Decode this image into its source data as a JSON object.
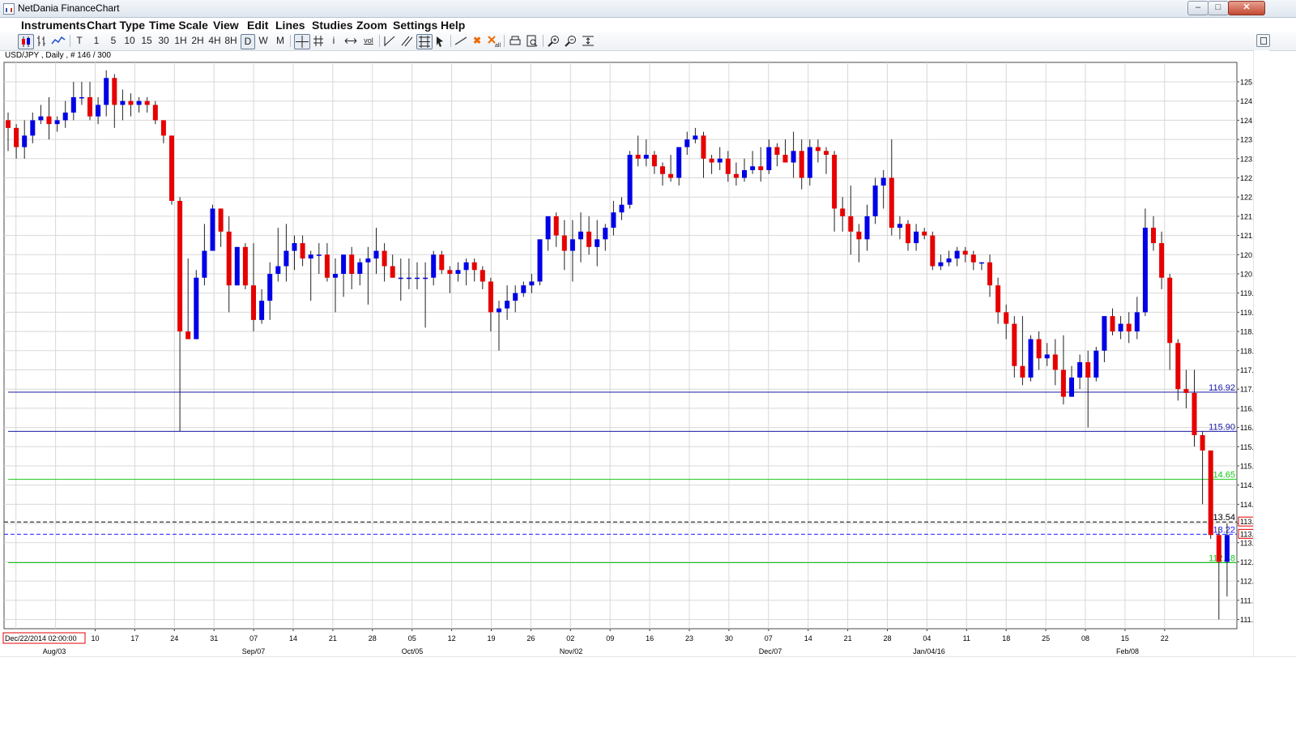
{
  "window": {
    "title": "NetDania FinanceChart",
    "min_glyph": "–",
    "max_glyph": "□",
    "close_glyph": "✕"
  },
  "menu": [
    "Instruments",
    "Chart Type",
    "Time Scale",
    "View",
    "Edit",
    "Lines",
    "Studies",
    "Zoom",
    "Settings",
    "Help"
  ],
  "toolbar": {
    "timescales": [
      "T",
      "1",
      "5",
      "10",
      "15",
      "30",
      "1H",
      "2H",
      "4H",
      "8H",
      "D",
      "W",
      "M"
    ],
    "active_timescale": "D",
    "icons": [
      "candle-chart-icon",
      "bar-chart-icon",
      "line-chart-icon",
      "crosshair-icon",
      "grid-icon",
      "info-icon",
      "scroll-arrows-icon",
      "volume-icon",
      "trendline-icon",
      "channel-icon",
      "fibonacci-icon",
      "cursor-icon",
      "draw-line-icon",
      "delete-icon",
      "delete-all-icon",
      "print-icon",
      "print-preview-icon",
      "zoom-in-icon",
      "zoom-out-icon",
      "zoom-fit-icon"
    ],
    "glyphs": {
      "volume": "vol",
      "info": "i",
      "delete": "✖"
    }
  },
  "instrument_info": "USD/JPY , Daily , # 146 / 300",
  "crosshair_date": "Dec/22/2014 02:00:00",
  "chart_data": {
    "type": "candlestick",
    "instrument": "USD/JPY",
    "timeframe": "Daily",
    "yaxis": {
      "min": 111.0,
      "max": 125.0,
      "step": 0.5,
      "position": "right"
    },
    "x_day_labels": [
      "10",
      "17",
      "24",
      "31",
      "07",
      "14",
      "21",
      "28",
      "05",
      "12",
      "19",
      "26",
      "02",
      "09",
      "16",
      "23",
      "30",
      "07",
      "14",
      "21",
      "28",
      "04",
      "11",
      "18",
      "25",
      "08",
      "15",
      "22"
    ],
    "x_month_labels": [
      "Aug/03",
      "Sep/07",
      "Oct/05",
      "Nov/02",
      "Dec/07",
      "Jan/04/16",
      "Feb/08"
    ],
    "grid": true,
    "horizontal_lines": [
      {
        "value": 116.92,
        "label": "116.92",
        "color": "#1a1aa6",
        "style": "solid"
      },
      {
        "value": 115.9,
        "label": "115.90",
        "color": "#1a1aa6",
        "style": "solid"
      },
      {
        "value": 114.65,
        "label": "114.65",
        "color": "#14c814",
        "style": "solid"
      },
      {
        "value": 113.54,
        "label": "113.54",
        "color": "#000000",
        "style": "dashed"
      },
      {
        "value": 113.22,
        "label": "113.22",
        "color": "#2020ff",
        "style": "dashed"
      },
      {
        "value": 112.48,
        "label": "112.48",
        "color": "#14c814",
        "style": "solid"
      }
    ],
    "price_tags": [
      {
        "value": 113.54,
        "label": "113.54"
      },
      {
        "value": 113.22,
        "label": "113.22"
      }
    ],
    "up_color": "#0000e6",
    "down_color": "#e60000",
    "candles": [
      [
        124.0,
        124.2,
        123.2,
        123.8
      ],
      [
        123.8,
        123.9,
        123.0,
        123.3
      ],
      [
        123.3,
        124.0,
        123.0,
        123.6
      ],
      [
        123.6,
        124.2,
        123.4,
        124.0
      ],
      [
        124.0,
        124.4,
        123.9,
        124.1
      ],
      [
        124.1,
        124.6,
        123.5,
        123.9
      ],
      [
        123.9,
        124.1,
        123.7,
        124.0
      ],
      [
        124.0,
        124.5,
        123.8,
        124.2
      ],
      [
        124.2,
        125.0,
        124.0,
        124.6
      ],
      [
        124.6,
        125.0,
        124.4,
        124.6
      ],
      [
        124.6,
        125.0,
        124.0,
        124.1
      ],
      [
        124.1,
        124.6,
        123.9,
        124.4
      ],
      [
        124.4,
        125.3,
        124.1,
        125.1
      ],
      [
        125.1,
        125.2,
        123.8,
        124.4
      ],
      [
        124.4,
        124.8,
        124.0,
        124.5
      ],
      [
        124.5,
        124.7,
        124.1,
        124.4
      ],
      [
        124.4,
        124.6,
        124.2,
        124.5
      ],
      [
        124.5,
        124.6,
        124.2,
        124.4
      ],
      [
        124.4,
        124.5,
        123.9,
        124.0
      ],
      [
        124.0,
        124.0,
        123.4,
        123.6
      ],
      [
        123.6,
        123.6,
        121.8,
        121.9
      ],
      [
        121.9,
        122.0,
        115.9,
        118.5
      ],
      [
        118.5,
        120.4,
        118.4,
        118.3
      ],
      [
        118.3,
        120.1,
        118.3,
        119.9
      ],
      [
        119.9,
        121.3,
        119.7,
        120.6
      ],
      [
        120.6,
        121.8,
        120.6,
        121.7
      ],
      [
        121.7,
        121.7,
        120.7,
        121.1
      ],
      [
        121.1,
        121.5,
        119.0,
        119.7
      ],
      [
        119.7,
        120.7,
        119.7,
        120.7
      ],
      [
        120.7,
        120.8,
        119.6,
        119.7
      ],
      [
        119.7,
        120.8,
        118.5,
        118.8
      ],
      [
        118.8,
        119.6,
        118.7,
        119.3
      ],
      [
        119.3,
        120.3,
        118.8,
        120.0
      ],
      [
        120.0,
        121.2,
        119.8,
        120.2
      ],
      [
        120.2,
        121.3,
        119.8,
        120.6
      ],
      [
        120.6,
        121.0,
        120.1,
        120.8
      ],
      [
        120.8,
        121.0,
        120.2,
        120.4
      ],
      [
        120.4,
        120.6,
        119.3,
        120.5
      ],
      [
        120.5,
        120.8,
        120.0,
        120.5
      ],
      [
        120.5,
        120.8,
        119.8,
        119.9
      ],
      [
        119.9,
        120.4,
        119.0,
        120.0
      ],
      [
        120.0,
        120.5,
        119.4,
        120.5
      ],
      [
        120.5,
        120.7,
        119.6,
        120.0
      ],
      [
        120.0,
        120.4,
        119.7,
        120.3
      ],
      [
        120.3,
        120.7,
        119.2,
        120.4
      ],
      [
        120.4,
        121.2,
        120.0,
        120.6
      ],
      [
        120.6,
        120.8,
        119.8,
        120.2
      ],
      [
        120.2,
        120.5,
        119.9,
        119.9
      ],
      [
        119.9,
        120.4,
        119.3,
        119.9
      ],
      [
        119.9,
        120.4,
        119.6,
        119.9
      ],
      [
        119.9,
        120.3,
        119.6,
        119.9
      ],
      [
        119.9,
        120.3,
        118.6,
        119.9
      ],
      [
        119.9,
        120.6,
        119.7,
        120.5
      ],
      [
        120.5,
        120.6,
        120.0,
        120.1
      ],
      [
        120.1,
        120.2,
        119.5,
        120.0
      ],
      [
        120.0,
        120.3,
        119.8,
        120.1
      ],
      [
        120.1,
        120.4,
        119.7,
        120.3
      ],
      [
        120.3,
        120.4,
        119.8,
        120.1
      ],
      [
        120.1,
        120.2,
        119.6,
        119.8
      ],
      [
        119.8,
        119.9,
        118.5,
        119.0
      ],
      [
        119.0,
        119.3,
        118.0,
        119.1
      ],
      [
        119.1,
        119.7,
        118.8,
        119.3
      ],
      [
        119.3,
        119.7,
        119.0,
        119.5
      ],
      [
        119.5,
        119.8,
        119.4,
        119.7
      ],
      [
        119.7,
        120.0,
        119.5,
        119.8
      ],
      [
        119.8,
        120.8,
        119.7,
        120.9
      ],
      [
        120.9,
        121.5,
        120.6,
        121.5
      ],
      [
        121.5,
        121.6,
        120.7,
        121.0
      ],
      [
        121.0,
        121.4,
        120.1,
        120.6
      ],
      [
        120.6,
        121.4,
        119.8,
        120.9
      ],
      [
        120.9,
        121.6,
        120.3,
        121.1
      ],
      [
        121.1,
        121.5,
        120.5,
        120.7
      ],
      [
        120.7,
        121.4,
        120.2,
        120.9
      ],
      [
        120.9,
        121.3,
        120.6,
        121.2
      ],
      [
        121.2,
        121.9,
        121.0,
        121.6
      ],
      [
        121.6,
        122.0,
        121.4,
        121.8
      ],
      [
        121.8,
        123.2,
        121.7,
        123.1
      ],
      [
        123.1,
        123.6,
        122.8,
        123.0
      ],
      [
        123.0,
        123.5,
        122.8,
        123.1
      ],
      [
        123.1,
        123.2,
        122.6,
        122.8
      ],
      [
        122.8,
        122.9,
        122.3,
        122.6
      ],
      [
        122.6,
        123.1,
        122.4,
        122.5
      ],
      [
        122.5,
        123.3,
        122.3,
        123.3
      ],
      [
        123.3,
        123.7,
        123.1,
        123.5
      ],
      [
        123.5,
        123.8,
        123.4,
        123.6
      ],
      [
        123.6,
        123.7,
        122.5,
        123.0
      ],
      [
        123.0,
        123.1,
        122.6,
        122.9
      ],
      [
        122.9,
        123.3,
        122.7,
        123.0
      ],
      [
        123.0,
        123.2,
        122.4,
        122.6
      ],
      [
        122.6,
        122.9,
        122.3,
        122.5
      ],
      [
        122.5,
        123.0,
        122.4,
        122.7
      ],
      [
        122.7,
        123.2,
        122.6,
        122.8
      ],
      [
        122.8,
        123.3,
        122.4,
        122.7
      ],
      [
        122.7,
        123.5,
        122.6,
        123.3
      ],
      [
        123.3,
        123.4,
        122.8,
        123.1
      ],
      [
        123.1,
        123.5,
        122.9,
        122.9
      ],
      [
        122.9,
        123.7,
        122.5,
        123.2
      ],
      [
        123.2,
        123.5,
        122.2,
        122.5
      ],
      [
        122.5,
        123.5,
        122.3,
        123.3
      ],
      [
        123.3,
        123.5,
        122.9,
        123.2
      ],
      [
        123.2,
        123.3,
        122.6,
        123.1
      ],
      [
        123.1,
        123.2,
        121.1,
        121.7
      ],
      [
        121.7,
        122.0,
        121.1,
        121.5
      ],
      [
        121.5,
        122.3,
        120.5,
        121.1
      ],
      [
        121.1,
        121.3,
        120.3,
        120.9
      ],
      [
        120.9,
        121.8,
        120.6,
        121.5
      ],
      [
        121.5,
        122.5,
        121.3,
        122.3
      ],
      [
        122.3,
        122.7,
        121.7,
        122.5
      ],
      [
        122.5,
        123.5,
        121.0,
        121.2
      ],
      [
        121.2,
        121.5,
        120.9,
        121.3
      ],
      [
        121.3,
        121.4,
        120.6,
        120.8
      ],
      [
        120.8,
        121.3,
        120.6,
        121.1
      ],
      [
        121.1,
        121.2,
        120.9,
        121.0
      ],
      [
        121.0,
        121.1,
        120.1,
        120.2
      ],
      [
        120.2,
        120.5,
        120.1,
        120.3
      ],
      [
        120.3,
        120.6,
        120.2,
        120.4
      ],
      [
        120.4,
        120.7,
        120.2,
        120.6
      ],
      [
        120.6,
        120.7,
        120.3,
        120.5
      ],
      [
        120.5,
        120.6,
        120.1,
        120.3
      ],
      [
        120.3,
        120.3,
        120.1,
        120.3
      ],
      [
        120.3,
        120.5,
        119.4,
        119.7
      ],
      [
        119.7,
        119.9,
        118.7,
        119.0
      ],
      [
        119.0,
        119.2,
        118.3,
        118.7
      ],
      [
        118.7,
        118.9,
        117.3,
        117.6
      ],
      [
        117.6,
        118.9,
        117.1,
        117.3
      ],
      [
        117.3,
        118.4,
        117.2,
        118.3
      ],
      [
        118.3,
        118.5,
        117.5,
        117.8
      ],
      [
        117.8,
        118.2,
        117.6,
        117.9
      ],
      [
        117.9,
        118.3,
        117.1,
        117.5
      ],
      [
        117.5,
        118.4,
        116.6,
        116.8
      ],
      [
        116.8,
        117.6,
        116.8,
        117.3
      ],
      [
        117.3,
        117.9,
        117.0,
        117.7
      ],
      [
        117.7,
        118.0,
        116.0,
        117.3
      ],
      [
        117.3,
        118.1,
        117.2,
        118.0
      ],
      [
        118.0,
        118.9,
        117.7,
        118.9
      ],
      [
        118.9,
        119.1,
        118.4,
        118.5
      ],
      [
        118.5,
        118.9,
        118.3,
        118.7
      ],
      [
        118.7,
        119.0,
        118.2,
        118.5
      ],
      [
        118.5,
        119.4,
        118.3,
        119.0
      ],
      [
        119.0,
        121.7,
        118.9,
        121.2
      ],
      [
        121.2,
        121.5,
        120.6,
        120.8
      ],
      [
        120.8,
        121.1,
        119.6,
        119.9
      ],
      [
        119.9,
        120.0,
        117.5,
        118.2
      ],
      [
        118.2,
        118.3,
        116.7,
        117.0
      ],
      [
        117.0,
        117.5,
        116.5,
        116.9
      ],
      [
        116.9,
        117.5,
        115.5,
        115.8
      ],
      [
        115.8,
        115.9,
        114.0,
        115.4
      ],
      [
        115.4,
        115.4,
        113.1,
        113.2
      ],
      [
        113.2,
        113.4,
        111.0,
        112.5
      ],
      [
        112.5,
        113.5,
        111.6,
        113.2
      ]
    ]
  }
}
